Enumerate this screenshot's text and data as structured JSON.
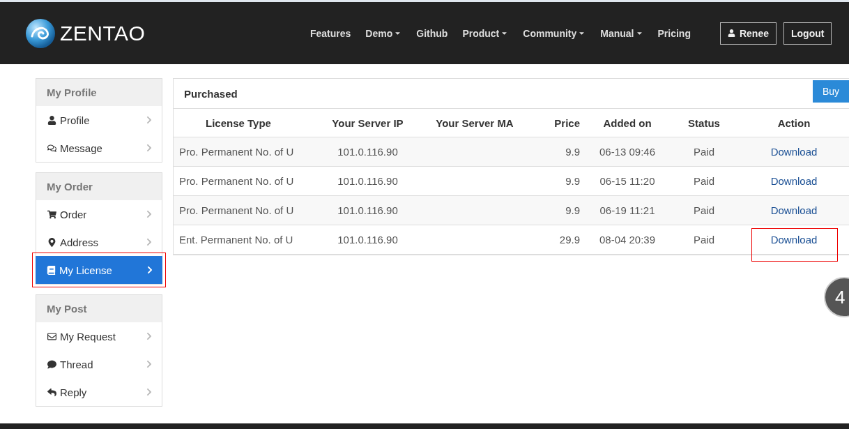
{
  "brand": {
    "name": "ZENTAO"
  },
  "nav": [
    {
      "label": "Features",
      "dropdown": false
    },
    {
      "label": "Demo",
      "dropdown": true
    },
    {
      "label": "Github",
      "dropdown": false
    },
    {
      "label": "Product",
      "dropdown": true
    },
    {
      "label": "Community",
      "dropdown": true
    },
    {
      "label": "Manual",
      "dropdown": true
    },
    {
      "label": "Pricing",
      "dropdown": false
    }
  ],
  "user_button": {
    "label": "Renee"
  },
  "logout_button": {
    "label": "Logout"
  },
  "sidebar": [
    {
      "title": "My Profile",
      "items": [
        {
          "kind": "user",
          "label": "Profile",
          "selected": false,
          "highlighted": false
        },
        {
          "kind": "comments",
          "label": "Message",
          "selected": false,
          "highlighted": false
        }
      ]
    },
    {
      "title": "My Order",
      "items": [
        {
          "kind": "cart",
          "label": "Order",
          "selected": false,
          "highlighted": false
        },
        {
          "kind": "marker",
          "label": "Address",
          "selected": false,
          "highlighted": false
        },
        {
          "kind": "book",
          "label": "My License",
          "selected": true,
          "highlighted": true
        }
      ]
    },
    {
      "title": "My Post",
      "items": [
        {
          "kind": "envelope",
          "label": "My Request",
          "selected": false,
          "highlighted": false
        },
        {
          "kind": "comment",
          "label": "Thread",
          "selected": false,
          "highlighted": false
        },
        {
          "kind": "reply",
          "label": "Reply",
          "selected": false,
          "highlighted": false
        }
      ]
    }
  ],
  "panel": {
    "title": "Purchased",
    "buy_button": "Buy",
    "columns": [
      "License Type",
      "Your Server IP",
      "Your Server MA",
      "Price",
      "Added on",
      "Status",
      "Action"
    ],
    "rows": [
      {
        "license_type": "Pro. Permanent No. of U",
        "server_ip": "101.0.116.90",
        "price": "9.9",
        "added_on": "06-13 09:46",
        "status": "Paid",
        "action": "Download",
        "action_highlighted": false
      },
      {
        "license_type": "Pro. Permanent No. of U",
        "server_ip": "101.0.116.90",
        "price": "9.9",
        "added_on": "06-15 11:20",
        "status": "Paid",
        "action": "Download",
        "action_highlighted": false
      },
      {
        "license_type": "Pro. Permanent No. of U",
        "server_ip": "101.0.116.90",
        "price": "9.9",
        "added_on": "06-19 11:21",
        "status": "Paid",
        "action": "Download",
        "action_highlighted": false
      },
      {
        "license_type": "Ent. Permanent No. of U",
        "server_ip": "101.0.116.90",
        "price": "29.9",
        "added_on": "08-04 20:39",
        "status": "Paid",
        "action": "Download",
        "action_highlighted": true
      }
    ]
  },
  "floating_badge": "4"
}
